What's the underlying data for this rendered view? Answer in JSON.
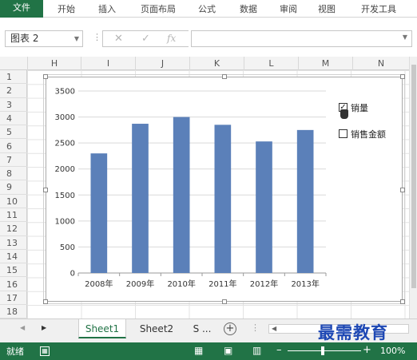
{
  "ribbon": {
    "tabs": [
      "文件",
      "开始",
      "插入",
      "页面布局",
      "公式",
      "数据",
      "审阅",
      "视图",
      "开发工具"
    ],
    "accent": "#217346"
  },
  "formula_bar": {
    "name_box": "图表 2",
    "fx_label": "fx",
    "cancel_icon": "x-icon",
    "enter_icon": "check-icon"
  },
  "grid": {
    "columns": [
      "H",
      "I",
      "J",
      "K",
      "L",
      "M",
      "N"
    ],
    "rows": [
      "1",
      "2",
      "3",
      "4",
      "5",
      "6",
      "7",
      "8",
      "9",
      "10",
      "11",
      "12",
      "13",
      "14",
      "15",
      "16",
      "17",
      "18"
    ]
  },
  "chart_data": {
    "type": "bar",
    "categories": [
      "2008年",
      "2009年",
      "2010年",
      "2011年",
      "2012年",
      "2013年"
    ],
    "series": [
      {
        "name": "销量",
        "values": [
          2300,
          2870,
          3000,
          2850,
          2530,
          2750
        ],
        "color": "#5b80b9"
      }
    ],
    "yticks": [
      "0",
      "500",
      "1000",
      "1500",
      "2000",
      "2500",
      "3000",
      "3500"
    ],
    "ylim": [
      0,
      3500
    ],
    "grid": true
  },
  "legend": {
    "items": [
      {
        "label": "销量",
        "checked": true
      },
      {
        "label": "销售金额",
        "checked": false
      }
    ]
  },
  "sheet_tabs": {
    "tabs": [
      "Sheet1",
      "Sheet2",
      "S ..."
    ],
    "add_label": "+"
  },
  "status_bar": {
    "ready": "就绪",
    "zoom": "100%"
  },
  "watermark": "最需教育"
}
